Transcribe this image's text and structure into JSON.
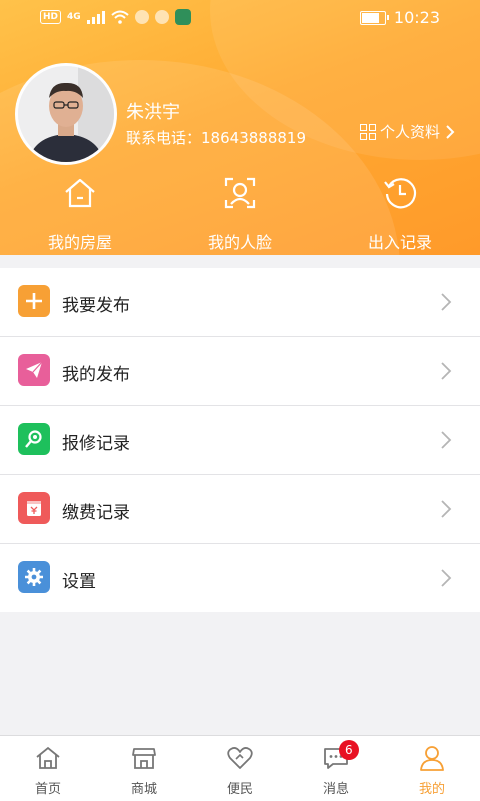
{
  "status_bar": {
    "time": "10:23",
    "network": "4G",
    "hd": "HD"
  },
  "profile": {
    "name": "朱洪宇",
    "phone_label": "联系电话：",
    "phone": "18643888819",
    "profile_link": "个人资料"
  },
  "quick_actions": [
    {
      "label": "我的房屋",
      "icon": "house-icon"
    },
    {
      "label": "我的人脸",
      "icon": "face-scan-icon"
    },
    {
      "label": "出入记录",
      "icon": "history-clock-icon"
    }
  ],
  "menu": [
    {
      "label": "我要发布",
      "icon": "plus-icon",
      "color": "#f7a035"
    },
    {
      "label": "我的发布",
      "icon": "send-icon",
      "color": "#e85f9a"
    },
    {
      "label": "报修记录",
      "icon": "repair-search-icon",
      "color": "#1ec05c"
    },
    {
      "label": "缴费记录",
      "icon": "payment-icon",
      "color": "#ef5a5a"
    },
    {
      "label": "设置",
      "icon": "settings-gear-icon",
      "color": "#4a90d9"
    }
  ],
  "tabs": [
    {
      "label": "首页",
      "icon": "home-icon"
    },
    {
      "label": "商城",
      "icon": "shop-icon"
    },
    {
      "label": "便民",
      "icon": "heart-icon"
    },
    {
      "label": "消息",
      "icon": "message-icon",
      "badge": "6"
    },
    {
      "label": "我的",
      "icon": "person-icon",
      "active": true
    }
  ],
  "colors": {
    "accent": "#f7a035",
    "badge": "#e81123"
  }
}
